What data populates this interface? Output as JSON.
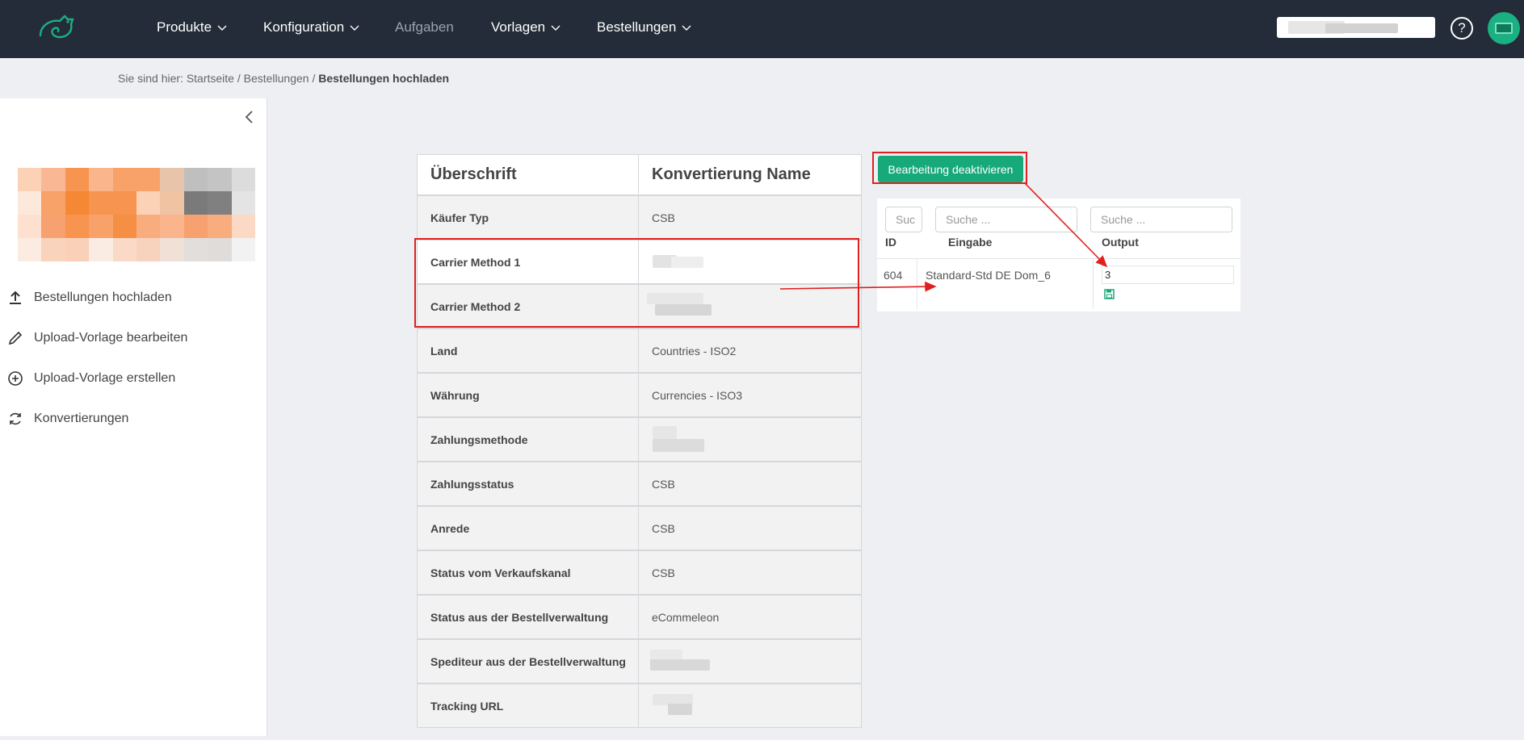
{
  "nav": {
    "items": [
      "Produkte",
      "Konfiguration",
      "Aufgaben",
      "Vorlagen",
      "Bestellungen"
    ],
    "help": "?"
  },
  "breadcrumb": {
    "prefix": "Sie sind hier: Startseite / Bestellungen / ",
    "current": "Bestellungen hochladen"
  },
  "sidebar": {
    "items": [
      "Bestellungen hochladen",
      "Upload-Vorlage bearbeiten",
      "Upload-Vorlage erstellen",
      "Konvertierungen"
    ]
  },
  "table": {
    "headers": [
      "Überschrift",
      "Konvertierung Name"
    ],
    "rows": [
      {
        "key": "Käufer Typ",
        "value": "CSB"
      },
      {
        "key": "Carrier Method 1",
        "value": ""
      },
      {
        "key": "Carrier Method 2",
        "value": ""
      },
      {
        "key": "Land",
        "value": "Countries - ISO2"
      },
      {
        "key": "Währung",
        "value": "Currencies - ISO3"
      },
      {
        "key": "Zahlungsmethode",
        "value": ""
      },
      {
        "key": "Zahlungsstatus",
        "value": "CSB"
      },
      {
        "key": "Anrede",
        "value": "CSB"
      },
      {
        "key": "Status vom Verkaufskanal",
        "value": "CSB"
      },
      {
        "key": "Status aus der Bestellverwaltung",
        "value": "eCommeleon"
      },
      {
        "key": "Spediteur aus der Bestellverwaltung",
        "value": ""
      },
      {
        "key": "Tracking URL",
        "value": ""
      }
    ]
  },
  "conversion": {
    "toggle_button": "Bearbeitung deaktivieren",
    "search_placeholders": [
      "Suc",
      "Suche ...",
      "Suche ..."
    ],
    "columns": [
      "ID",
      "Eingabe",
      "Output"
    ],
    "row": {
      "id": "604",
      "input": "Standard-Std DE Dom_6",
      "output": "3"
    }
  },
  "colors": {
    "navbar": "#232c38",
    "accent": "#17a97a",
    "highlight": "#e02020"
  }
}
